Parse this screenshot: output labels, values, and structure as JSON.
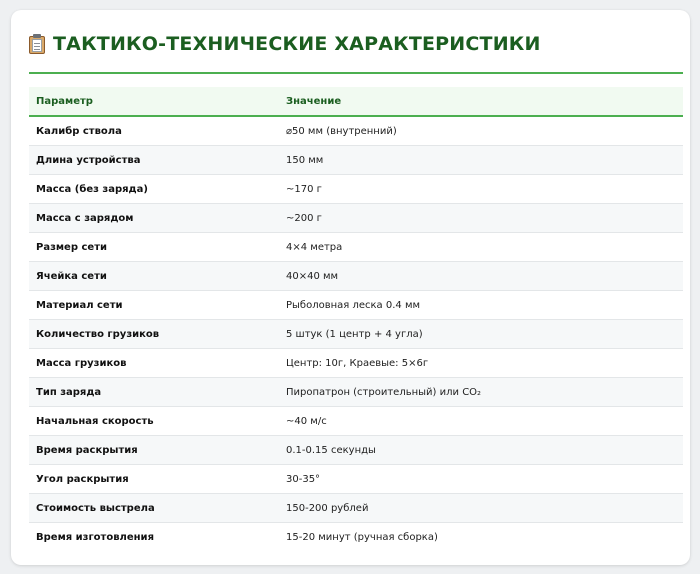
{
  "header": {
    "icon": "clipboard-icon",
    "title": "ТАКТИКО-ТЕХНИЧЕСКИЕ ХАРАКТЕРИСТИКИ"
  },
  "colors": {
    "accent": "#4caf50",
    "title": "#1b5e20",
    "header_bg": "#f1faf1"
  },
  "table": {
    "columns": [
      "Параметр",
      "Значение"
    ],
    "rows": [
      {
        "param": "Калибр ствола",
        "value": "⌀50 мм (внутренний)"
      },
      {
        "param": "Длина устройства",
        "value": "150 мм"
      },
      {
        "param": "Масса (без заряда)",
        "value": "~170 г"
      },
      {
        "param": "Масса с зарядом",
        "value": "~200 г"
      },
      {
        "param": "Размер сети",
        "value": "4×4 метра"
      },
      {
        "param": "Ячейка сети",
        "value": "40×40 мм"
      },
      {
        "param": "Материал сети",
        "value": "Рыболовная леска 0.4 мм"
      },
      {
        "param": "Количество грузиков",
        "value": "5 штук (1 центр + 4 угла)"
      },
      {
        "param": "Масса грузиков",
        "value": "Центр: 10г, Краевые: 5×6г"
      },
      {
        "param": "Тип заряда",
        "value": "Пиропатрон (строительный) или CO₂"
      },
      {
        "param": "Начальная скорость",
        "value": "~40 м/с"
      },
      {
        "param": "Время раскрытия",
        "value": "0.1-0.15 секунды"
      },
      {
        "param": "Угол раскрытия",
        "value": "30-35°"
      },
      {
        "param": "Стоимость выстрела",
        "value": "150-200 рублей"
      },
      {
        "param": "Время изготовления",
        "value": "15-20 минут (ручная сборка)"
      }
    ]
  }
}
